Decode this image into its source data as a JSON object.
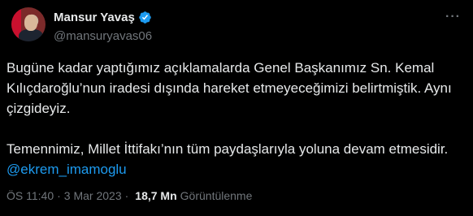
{
  "author": {
    "name": "Mansur Yavaş",
    "handle": "@mansuryavas06",
    "verified": true
  },
  "tweet": {
    "line1": "Bugüne kadar yaptığımız açıklamalarda Genel Başkanımız Sn. Kemal",
    "line2": "Kılıçdaroğlu’nun iradesi dışında hareket etmeyeceğimizi belirtmiştik. Aynı",
    "line3": "çizgideyiz.",
    "line4": "Temennimiz, Millet İttifakı’nın tüm paydaşlarıyla yoluna devam etmesidir.",
    "mention": "@ekrem_imamoglu"
  },
  "meta": {
    "time": "ÖS 11:40",
    "date": "3 Mar 2023",
    "views_count": "18,7 Mn",
    "views_label": "Görüntülenme",
    "separator": "·"
  },
  "icons": {
    "more": "more-icon",
    "verified": "verified-badge-icon"
  },
  "colors": {
    "background": "#000000",
    "text": "#e7e9ea",
    "muted": "#71767b",
    "accent": "#1d9bf0"
  }
}
